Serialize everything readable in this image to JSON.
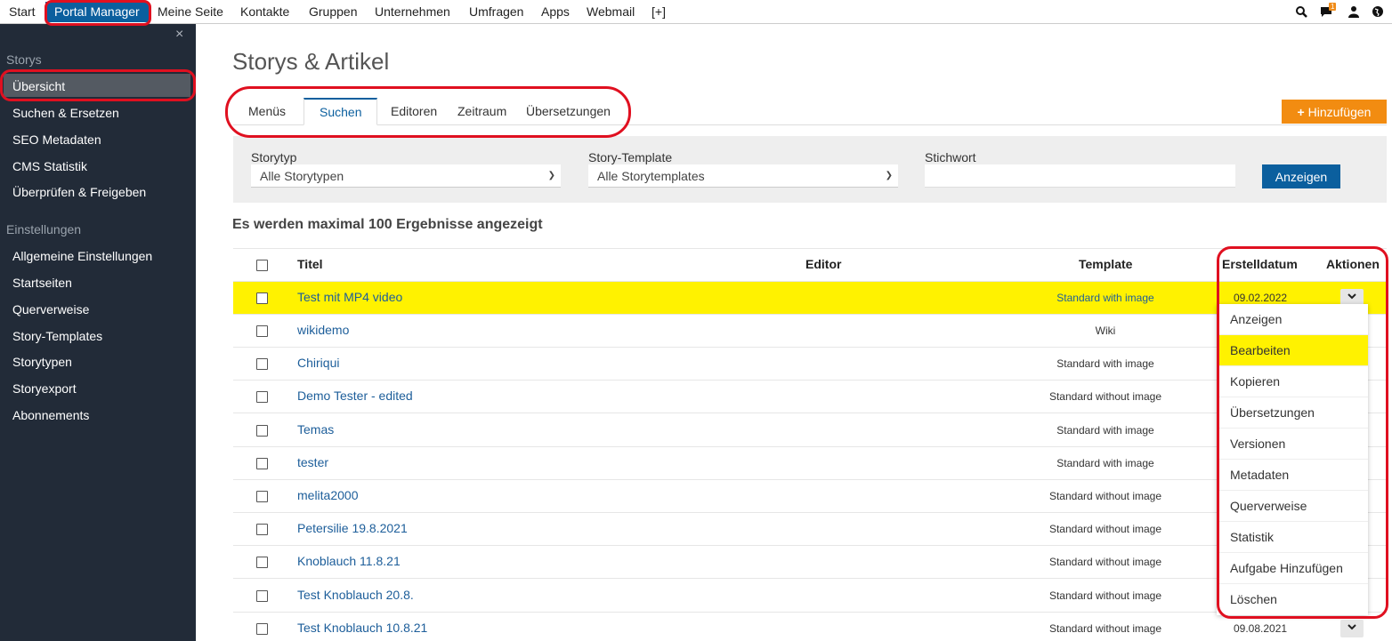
{
  "topnav": {
    "items": [
      "Start",
      "Portal Manager",
      "Meine Seite",
      "Kontakte",
      "Gruppen",
      "Unternehmen",
      "Umfragen",
      "Apps",
      "Webmail",
      "[+]"
    ],
    "notification_count": "1",
    "icons": [
      "search-icon",
      "chat-icon",
      "user-icon",
      "globe-icon"
    ]
  },
  "sidebar": {
    "close_label": "×",
    "section_storys": "Storys",
    "storys_items": [
      "Übersicht",
      "Suchen & Ersetzen",
      "SEO Metadaten",
      "CMS Statistik",
      "Überprüfen & Freigeben"
    ],
    "section_settings": "Einstellungen",
    "settings_items": [
      "Allgemeine Einstellungen",
      "Startseiten",
      "Querverweise",
      "Story-Templates",
      "Storytypen",
      "Storyexport",
      "Abonnements"
    ]
  },
  "main": {
    "title": "Storys & Artikel",
    "tabs": [
      "Menüs",
      "Suchen",
      "Editoren",
      "Zeitraum",
      "Übersetzungen"
    ],
    "add_button": "Hinzufügen",
    "add_icon": "+"
  },
  "filter": {
    "storytyp_label": "Storytyp",
    "storytyp_value": "Alle Storytypen",
    "template_label": "Story-Template",
    "template_value": "Alle Storytemplates",
    "keyword_label": "Stichwort",
    "keyword_value": "",
    "show_button": "Anzeigen"
  },
  "results_info": "Es werden maximal 100 Ergebnisse angezeigt",
  "table": {
    "columns": [
      "Titel",
      "Editor",
      "Template",
      "Erstelldatum",
      "Aktionen"
    ],
    "rows": [
      {
        "title": "Test mit MP4 video",
        "template": "Standard with image",
        "date": "09.02.2022"
      },
      {
        "title": "wikidemo",
        "template": "Wiki",
        "date": ""
      },
      {
        "title": "Chiriqui",
        "template": "Standard with image",
        "date": ""
      },
      {
        "title": "Demo Tester - edited",
        "template": "Standard without image",
        "date": ""
      },
      {
        "title": "Temas",
        "template": "Standard with image",
        "date": ""
      },
      {
        "title": "tester",
        "template": "Standard with image",
        "date": ""
      },
      {
        "title": "melita2000",
        "template": "Standard without image",
        "date": ""
      },
      {
        "title": "Petersilie 19.8.2021",
        "template": "Standard without image",
        "date": ""
      },
      {
        "title": "Knoblauch 11.8.21",
        "template": "Standard without image",
        "date": ""
      },
      {
        "title": "Test Knoblauch 20.8.",
        "template": "Standard without image",
        "date": ""
      },
      {
        "title": "Test Knoblauch 10.8.21",
        "template": "Standard without image",
        "date": "09.08.2021"
      }
    ]
  },
  "action_menu": [
    "Anzeigen",
    "Bearbeiten",
    "Kopieren",
    "Übersetzungen",
    "Versionen",
    "Metadaten",
    "Querverweise",
    "Statistik",
    "Aufgabe Hinzufügen",
    "Löschen"
  ],
  "colors": {
    "brand_blue": "#0b5f9e",
    "sidebar_bg": "#222b38",
    "highlight_yellow": "#fff200",
    "add_orange": "#f28c11",
    "annotation_red": "#e01020"
  }
}
